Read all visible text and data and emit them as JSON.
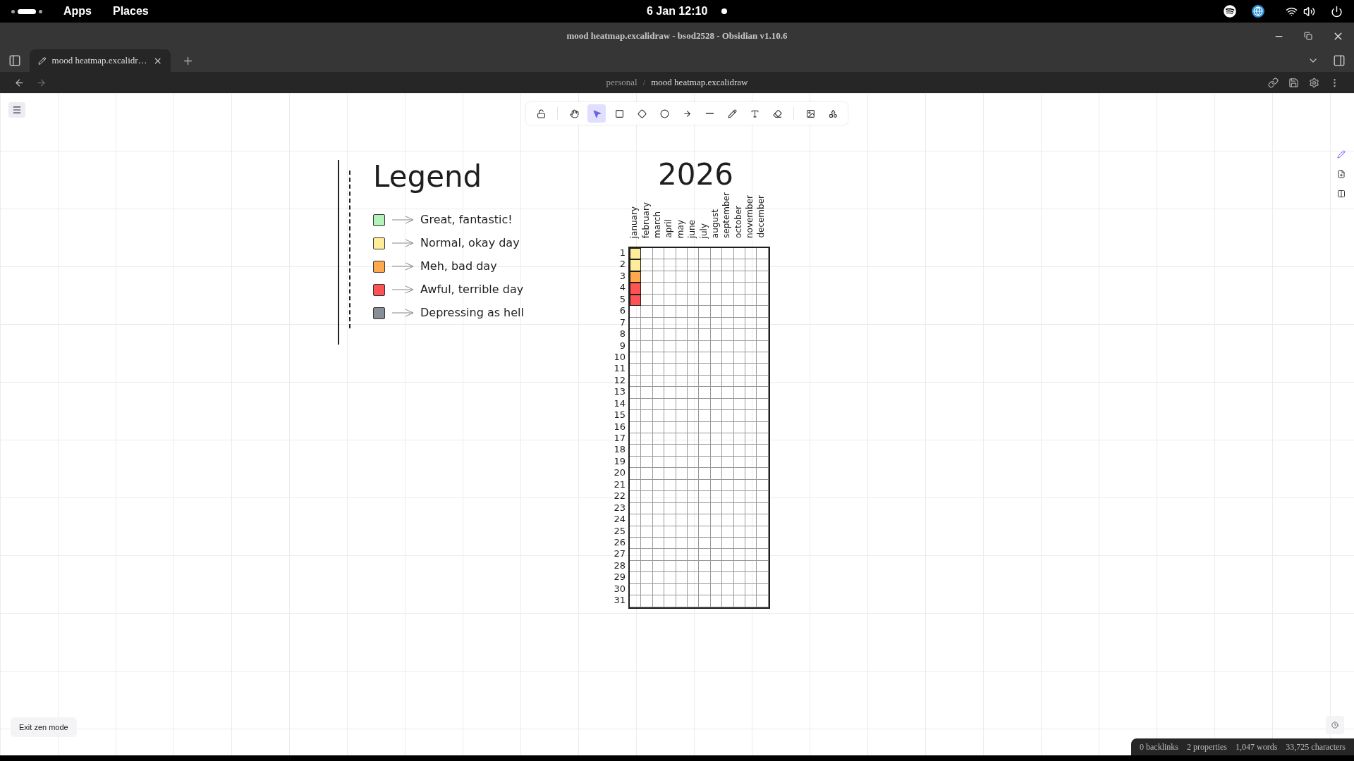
{
  "system_bar": {
    "menus": [
      "Apps",
      "Places"
    ],
    "clock": "6 Jan 12:10"
  },
  "window": {
    "title": "mood heatmap.excalidraw - bsod2528 - Obsidian v1.10.6"
  },
  "tabs": [
    {
      "label": "mood heatmap.excalidr…",
      "selected": true
    }
  ],
  "breadcrumb": {
    "folder": "personal",
    "separator": "/",
    "file": "mood heatmap.excalidraw"
  },
  "toolbar": {
    "groups": [
      [
        {
          "kind": "lock",
          "selected": false
        }
      ],
      [
        {
          "kind": "hand",
          "selected": false
        },
        {
          "kind": "select",
          "selected": true
        },
        {
          "kind": "rectangle",
          "selected": false
        },
        {
          "kind": "diamond",
          "selected": false
        },
        {
          "kind": "ellipse",
          "selected": false
        },
        {
          "kind": "arrow",
          "selected": false
        },
        {
          "kind": "line",
          "selected": false
        },
        {
          "kind": "draw",
          "selected": false
        },
        {
          "kind": "text",
          "selected": false
        },
        {
          "kind": "eraser",
          "selected": false
        }
      ],
      [
        {
          "kind": "image",
          "selected": false
        },
        {
          "kind": "library",
          "selected": false
        }
      ]
    ]
  },
  "legend": {
    "title": "Legend",
    "items": [
      {
        "label": "Great, fantastic!",
        "color": "#b2f2bb"
      },
      {
        "label": "Normal, okay day",
        "color": "#ffec99"
      },
      {
        "label": "Meh, bad day",
        "color": "#ffa94d"
      },
      {
        "label": "Awful, terrible day",
        "color": "#ff5252"
      },
      {
        "label": "Depressing as hell",
        "color": "#868e96"
      }
    ]
  },
  "heatmap": {
    "title": "2026",
    "months": [
      {
        "label": "january",
        "marks": [
          {
            "color": "#ffec99"
          },
          {
            "color": "#ffec99"
          },
          {
            "color": "#ffa94d"
          },
          {
            "color": "#ff5252"
          },
          {
            "color": "#ff5252"
          }
        ]
      },
      {
        "label": "february"
      },
      {
        "label": "march"
      },
      {
        "label": "april"
      },
      {
        "label": "may"
      },
      {
        "label": "june"
      },
      {
        "label": "july"
      },
      {
        "label": "august"
      },
      {
        "label": "september"
      },
      {
        "label": "october"
      },
      {
        "label": "november"
      },
      {
        "label": "december"
      }
    ],
    "days": [
      "1",
      "2",
      "3",
      "4",
      "5",
      "6",
      "7",
      "8",
      "9",
      "10",
      "11",
      "12",
      "13",
      "14",
      "15",
      "16",
      "17",
      "18",
      "19",
      "20",
      "21",
      "22",
      "23",
      "24",
      "25",
      "26",
      "27",
      "28",
      "29",
      "30",
      "31"
    ]
  },
  "zen_button": "Exit zen mode",
  "status_bar": [
    "0 backlinks",
    "2 properties",
    "1,047 words",
    "33,725 characters"
  ]
}
